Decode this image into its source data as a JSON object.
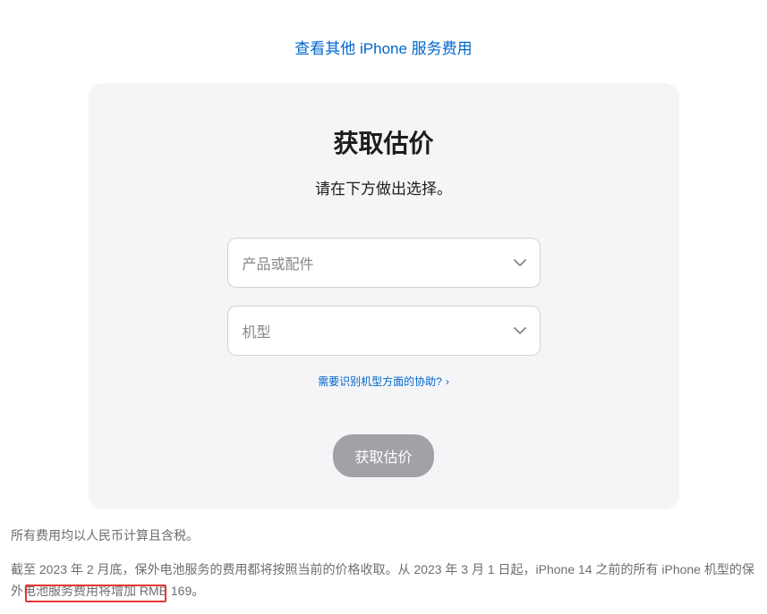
{
  "top_link": {
    "label": "查看其他 iPhone 服务费用"
  },
  "card": {
    "title": "获取估价",
    "subtitle": "请在下方做出选择。",
    "select1_placeholder": "产品或配件",
    "select2_placeholder": "机型",
    "help_label": "需要识别机型方面的协助?",
    "submit_label": "获取估价"
  },
  "footer": {
    "tax_note": "所有费用均以人民币计算且含税。",
    "price_note": "截至 2023 年 2 月底，保外电池服务的费用都将按照当前的价格收取。从 2023 年 3 月 1 日起，iPhone 14 之前的所有 iPhone 机型的保外电池服务费用将增加 RMB 169。"
  }
}
